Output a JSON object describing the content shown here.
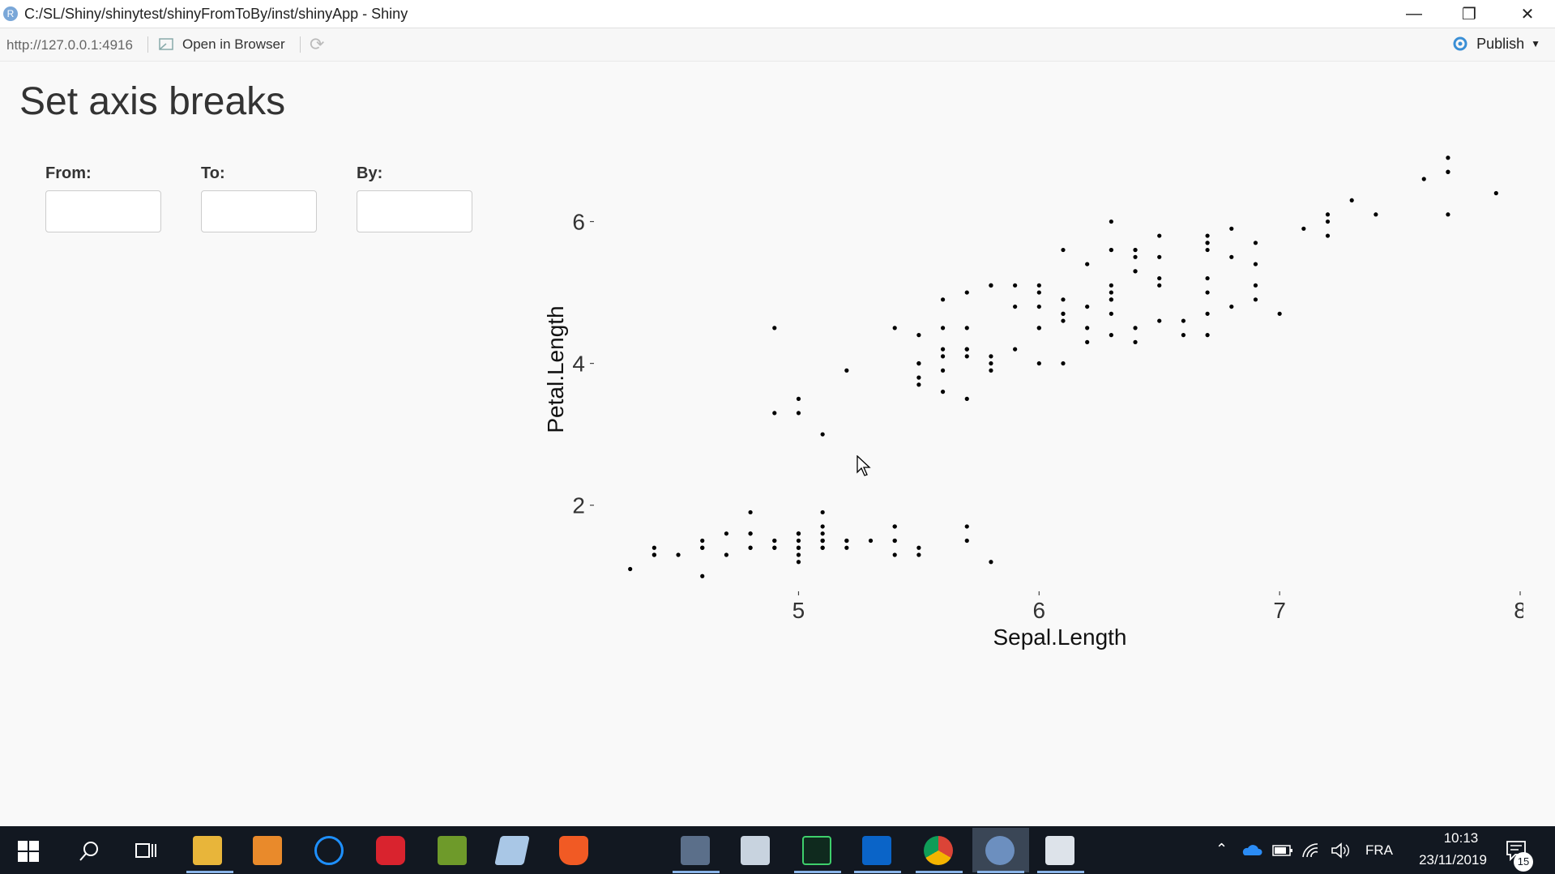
{
  "window": {
    "title": "C:/SL/Shiny/shinytest/shinyFromToBy/inst/shinyApp - Shiny",
    "app_icon_letter": "R",
    "minimize_glyph": "—",
    "maximize_glyph": "❐",
    "close_glyph": "✕"
  },
  "toolbar": {
    "url": "http://127.0.0.1:4916",
    "open_in_browser": "Open in Browser",
    "publish": "Publish"
  },
  "page": {
    "title": "Set axis breaks",
    "inputs": [
      {
        "label": "From:",
        "value": ""
      },
      {
        "label": "To:",
        "value": ""
      },
      {
        "label": "By:",
        "value": ""
      }
    ]
  },
  "chart_data": {
    "type": "scatter",
    "xlabel": "Sepal.Length",
    "ylabel": "Petal.Length",
    "xlim": [
      4.2,
      8.0
    ],
    "ylim": [
      0.9,
      7.0
    ],
    "x_ticks": [
      5,
      6,
      7,
      8
    ],
    "y_ticks": [
      2,
      4,
      6
    ],
    "grid": false,
    "points": [
      [
        5.1,
        1.4
      ],
      [
        4.9,
        1.4
      ],
      [
        4.7,
        1.3
      ],
      [
        4.6,
        1.5
      ],
      [
        5.0,
        1.4
      ],
      [
        5.4,
        1.7
      ],
      [
        4.6,
        1.4
      ],
      [
        5.0,
        1.5
      ],
      [
        4.4,
        1.4
      ],
      [
        4.9,
        1.5
      ],
      [
        5.4,
        1.5
      ],
      [
        4.8,
        1.6
      ],
      [
        4.8,
        1.4
      ],
      [
        4.3,
        1.1
      ],
      [
        5.8,
        1.2
      ],
      [
        5.7,
        1.5
      ],
      [
        5.4,
        1.3
      ],
      [
        5.1,
        1.4
      ],
      [
        5.7,
        1.7
      ],
      [
        5.1,
        1.5
      ],
      [
        5.4,
        1.7
      ],
      [
        5.1,
        1.5
      ],
      [
        4.6,
        1.0
      ],
      [
        5.1,
        1.7
      ],
      [
        4.8,
        1.9
      ],
      [
        5.0,
        1.6
      ],
      [
        5.0,
        1.6
      ],
      [
        5.2,
        1.5
      ],
      [
        5.2,
        1.4
      ],
      [
        4.7,
        1.6
      ],
      [
        4.8,
        1.6
      ],
      [
        5.4,
        1.5
      ],
      [
        5.2,
        1.5
      ],
      [
        5.5,
        1.4
      ],
      [
        4.9,
        1.5
      ],
      [
        5.0,
        1.2
      ],
      [
        5.5,
        1.3
      ],
      [
        4.9,
        1.4
      ],
      [
        4.4,
        1.3
      ],
      [
        5.1,
        1.5
      ],
      [
        5.0,
        1.3
      ],
      [
        4.5,
        1.3
      ],
      [
        4.4,
        1.3
      ],
      [
        5.0,
        1.6
      ],
      [
        5.1,
        1.9
      ],
      [
        4.8,
        1.4
      ],
      [
        5.1,
        1.6
      ],
      [
        4.6,
        1.4
      ],
      [
        5.3,
        1.5
      ],
      [
        5.0,
        1.4
      ],
      [
        7.0,
        4.7
      ],
      [
        6.4,
        4.5
      ],
      [
        6.9,
        4.9
      ],
      [
        5.5,
        4.0
      ],
      [
        6.5,
        4.6
      ],
      [
        5.7,
        4.5
      ],
      [
        6.3,
        4.7
      ],
      [
        4.9,
        3.3
      ],
      [
        6.6,
        4.6
      ],
      [
        5.2,
        3.9
      ],
      [
        5.0,
        3.5
      ],
      [
        5.9,
        4.2
      ],
      [
        6.0,
        4.0
      ],
      [
        6.1,
        4.7
      ],
      [
        5.6,
        3.6
      ],
      [
        6.7,
        4.4
      ],
      [
        5.6,
        4.5
      ],
      [
        5.8,
        4.1
      ],
      [
        6.2,
        4.5
      ],
      [
        5.6,
        3.9
      ],
      [
        5.9,
        4.8
      ],
      [
        6.1,
        4.0
      ],
      [
        6.3,
        4.9
      ],
      [
        6.1,
        4.7
      ],
      [
        6.4,
        4.3
      ],
      [
        6.6,
        4.4
      ],
      [
        6.8,
        4.8
      ],
      [
        6.7,
        5.0
      ],
      [
        6.0,
        4.5
      ],
      [
        5.7,
        3.5
      ],
      [
        5.5,
        3.8
      ],
      [
        5.5,
        3.7
      ],
      [
        5.8,
        3.9
      ],
      [
        6.0,
        5.1
      ],
      [
        5.4,
        4.5
      ],
      [
        6.0,
        4.5
      ],
      [
        6.7,
        4.7
      ],
      [
        6.3,
        4.4
      ],
      [
        5.6,
        4.1
      ],
      [
        5.5,
        4.0
      ],
      [
        5.5,
        4.4
      ],
      [
        6.1,
        4.6
      ],
      [
        5.8,
        4.0
      ],
      [
        5.0,
        3.3
      ],
      [
        5.6,
        4.2
      ],
      [
        5.7,
        4.2
      ],
      [
        5.7,
        4.2
      ],
      [
        6.2,
        4.3
      ],
      [
        5.1,
        3.0
      ],
      [
        5.7,
        4.1
      ],
      [
        6.3,
        6.0
      ],
      [
        5.8,
        5.1
      ],
      [
        7.1,
        5.9
      ],
      [
        6.3,
        5.6
      ],
      [
        6.5,
        5.8
      ],
      [
        7.6,
        6.6
      ],
      [
        4.9,
        4.5
      ],
      [
        7.3,
        6.3
      ],
      [
        6.7,
        5.8
      ],
      [
        7.2,
        6.1
      ],
      [
        6.5,
        5.1
      ],
      [
        6.4,
        5.3
      ],
      [
        6.8,
        5.5
      ],
      [
        5.7,
        5.0
      ],
      [
        5.8,
        5.1
      ],
      [
        6.4,
        5.3
      ],
      [
        6.5,
        5.5
      ],
      [
        7.7,
        6.7
      ],
      [
        7.7,
        6.9
      ],
      [
        6.0,
        5.0
      ],
      [
        6.9,
        5.7
      ],
      [
        5.6,
        4.9
      ],
      [
        7.7,
        6.7
      ],
      [
        6.3,
        4.9
      ],
      [
        6.7,
        5.7
      ],
      [
        7.2,
        6.0
      ],
      [
        6.2,
        4.8
      ],
      [
        6.1,
        4.9
      ],
      [
        6.4,
        5.6
      ],
      [
        7.2,
        5.8
      ],
      [
        7.4,
        6.1
      ],
      [
        7.9,
        6.4
      ],
      [
        6.4,
        5.6
      ],
      [
        6.3,
        5.1
      ],
      [
        6.1,
        5.6
      ],
      [
        7.7,
        6.1
      ],
      [
        6.3,
        5.6
      ],
      [
        6.4,
        5.5
      ],
      [
        6.0,
        4.8
      ],
      [
        6.9,
        5.4
      ],
      [
        6.7,
        5.6
      ],
      [
        6.9,
        5.1
      ],
      [
        5.8,
        5.1
      ],
      [
        6.8,
        5.9
      ],
      [
        6.7,
        5.7
      ],
      [
        6.7,
        5.2
      ],
      [
        6.3,
        5.0
      ],
      [
        6.5,
        5.2
      ],
      [
        6.2,
        5.4
      ],
      [
        5.9,
        5.1
      ]
    ]
  },
  "taskbar": {
    "language": "FRA",
    "time": "10:13",
    "date": "23/11/2019",
    "notification_count": "15"
  }
}
